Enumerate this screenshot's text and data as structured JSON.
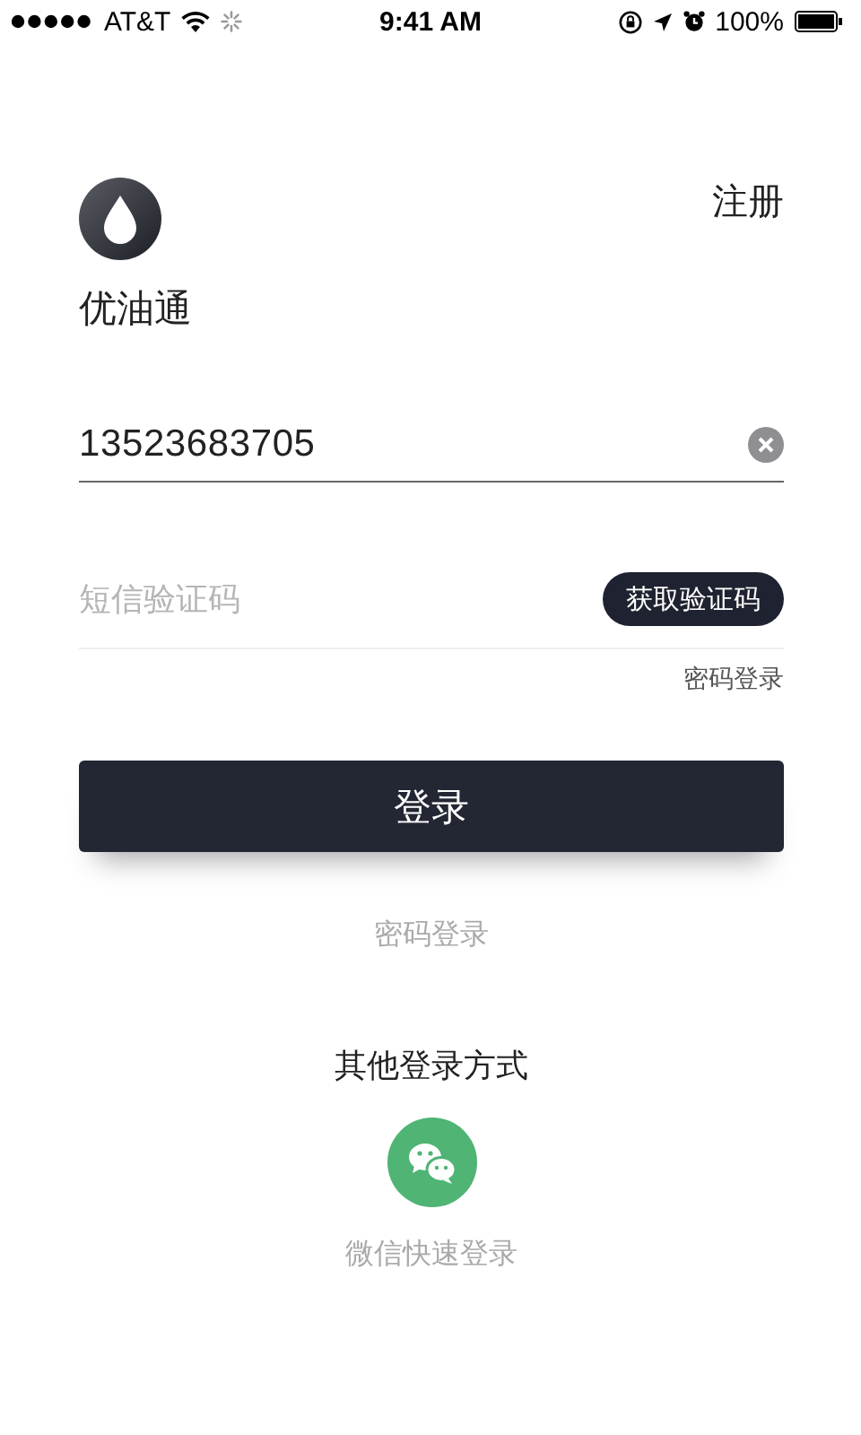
{
  "status_bar": {
    "carrier": "AT&T",
    "time": "9:41 AM",
    "battery": "100%"
  },
  "header": {
    "app_name": "优油通",
    "register_link": "注册"
  },
  "phone_field": {
    "value": "13523683705"
  },
  "code_field": {
    "placeholder": "短信验证码",
    "get_code_button": "获取验证码"
  },
  "password_login_link": "密码登录",
  "login_button": "登录",
  "alt_password_login": "密码登录",
  "other_login": {
    "title": "其他登录方式",
    "wechat_label": "微信快速登录"
  }
}
